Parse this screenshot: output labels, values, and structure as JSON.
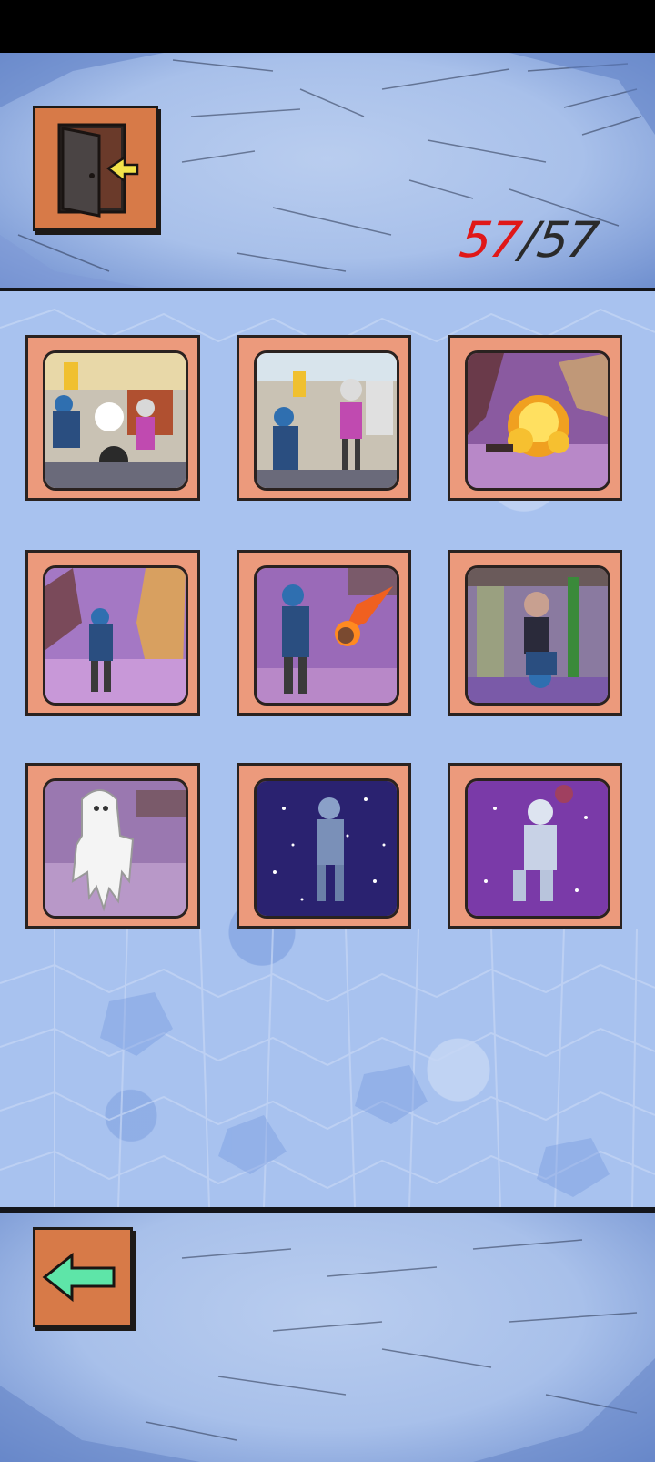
{
  "header": {
    "exit_icon": "door-exit-icon",
    "counter": {
      "current": "57",
      "separator": "/",
      "total": "57"
    }
  },
  "gallery": {
    "cards": [
      {
        "icon": "comic-panel-shop-brawl"
      },
      {
        "icon": "comic-panel-shop-standoff"
      },
      {
        "icon": "comic-panel-explosion"
      },
      {
        "icon": "comic-panel-canyon-walk"
      },
      {
        "icon": "comic-panel-meteor"
      },
      {
        "icon": "comic-panel-fall"
      },
      {
        "icon": "comic-panel-melting"
      },
      {
        "icon": "comic-panel-space-float"
      },
      {
        "icon": "comic-panel-ice-figure"
      }
    ]
  },
  "footer": {
    "back_icon": "arrow-left-icon"
  },
  "colors": {
    "card_frame": "#ec9a7c",
    "button_fill": "#d77a48",
    "counter_current": "#e01818",
    "counter_total": "#2a2a2a",
    "back_arrow": "#5ee5a8",
    "door_arrow": "#f3e34a",
    "background": "#a8c2ef"
  }
}
